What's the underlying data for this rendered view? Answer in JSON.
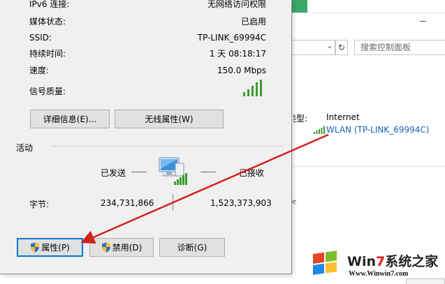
{
  "dialog": {
    "rows": [
      {
        "label": "IPv6 连接:",
        "value": "无网络访问权限"
      },
      {
        "label": "媒体状态:",
        "value": "已启用"
      },
      {
        "label": "SSID:",
        "value": "TP-LINK_69994C"
      },
      {
        "label": "持续时间:",
        "value": "1 天 08:18:17"
      },
      {
        "label": "速度:",
        "value": "150.0 Mbps"
      },
      {
        "label": "信号质量:",
        "value": ""
      }
    ],
    "signal_quality_bars": 5,
    "buttons": {
      "details": "详细信息(E)...",
      "wireless_properties": "无线属性(W)",
      "properties": "属性(P)",
      "disable": "禁用(D)",
      "diagnose": "诊断(G)"
    },
    "activity": {
      "title": "活动",
      "sent_label": "已发送",
      "received_label": "已接收",
      "bytes_label": "字节:",
      "bytes_sent": "234,731,866",
      "bytes_received": "1,523,373,903"
    }
  },
  "background_window": {
    "search_placeholder": "搜索控制面板",
    "type_label": "类型:",
    "type_value": "Internet",
    "connection_link": "WLAN (TP-LINK_69994C)",
    "truncated_mark": "e"
  },
  "watermark": {
    "brand_prefix": "Win",
    "brand_seven": "7",
    "brand_suffix": "系统之家",
    "url": "Www.Winwin7.com"
  },
  "colors": {
    "accent_link": "#1a5fb4",
    "annotation_arrow": "#d42020",
    "signal_green": "#3c9c2e",
    "focus_border": "#0078d7"
  },
  "icons": [
    "signal-bars-icon",
    "network-pc-icon",
    "shield-icon",
    "refresh-icon",
    "chevron-down-icon",
    "windows-logo-icon"
  ]
}
